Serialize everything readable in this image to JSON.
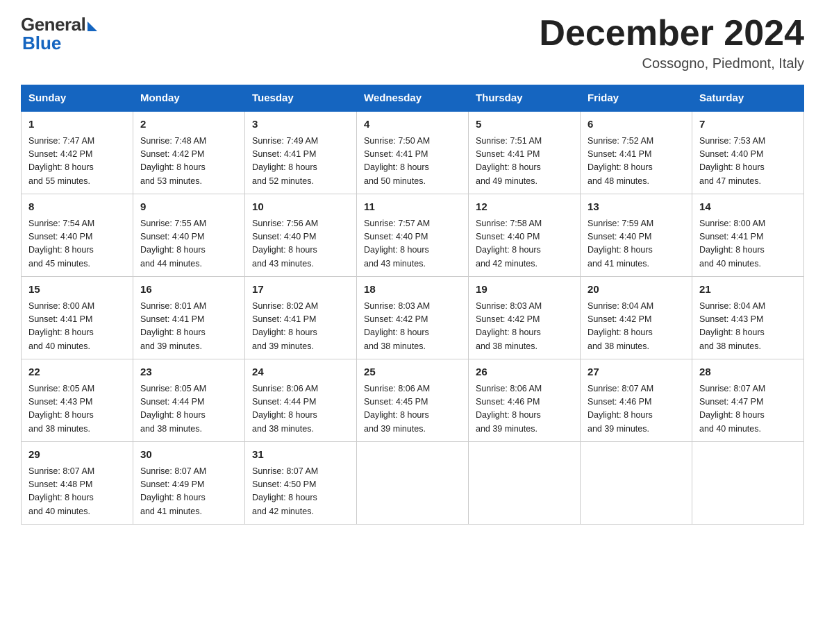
{
  "header": {
    "logo_general": "General",
    "logo_blue": "Blue",
    "month_title": "December 2024",
    "location": "Cossogno, Piedmont, Italy"
  },
  "days_of_week": [
    "Sunday",
    "Monday",
    "Tuesday",
    "Wednesday",
    "Thursday",
    "Friday",
    "Saturday"
  ],
  "weeks": [
    [
      {
        "day": "1",
        "info": "Sunrise: 7:47 AM\nSunset: 4:42 PM\nDaylight: 8 hours\nand 55 minutes."
      },
      {
        "day": "2",
        "info": "Sunrise: 7:48 AM\nSunset: 4:42 PM\nDaylight: 8 hours\nand 53 minutes."
      },
      {
        "day": "3",
        "info": "Sunrise: 7:49 AM\nSunset: 4:41 PM\nDaylight: 8 hours\nand 52 minutes."
      },
      {
        "day": "4",
        "info": "Sunrise: 7:50 AM\nSunset: 4:41 PM\nDaylight: 8 hours\nand 50 minutes."
      },
      {
        "day": "5",
        "info": "Sunrise: 7:51 AM\nSunset: 4:41 PM\nDaylight: 8 hours\nand 49 minutes."
      },
      {
        "day": "6",
        "info": "Sunrise: 7:52 AM\nSunset: 4:41 PM\nDaylight: 8 hours\nand 48 minutes."
      },
      {
        "day": "7",
        "info": "Sunrise: 7:53 AM\nSunset: 4:40 PM\nDaylight: 8 hours\nand 47 minutes."
      }
    ],
    [
      {
        "day": "8",
        "info": "Sunrise: 7:54 AM\nSunset: 4:40 PM\nDaylight: 8 hours\nand 45 minutes."
      },
      {
        "day": "9",
        "info": "Sunrise: 7:55 AM\nSunset: 4:40 PM\nDaylight: 8 hours\nand 44 minutes."
      },
      {
        "day": "10",
        "info": "Sunrise: 7:56 AM\nSunset: 4:40 PM\nDaylight: 8 hours\nand 43 minutes."
      },
      {
        "day": "11",
        "info": "Sunrise: 7:57 AM\nSunset: 4:40 PM\nDaylight: 8 hours\nand 43 minutes."
      },
      {
        "day": "12",
        "info": "Sunrise: 7:58 AM\nSunset: 4:40 PM\nDaylight: 8 hours\nand 42 minutes."
      },
      {
        "day": "13",
        "info": "Sunrise: 7:59 AM\nSunset: 4:40 PM\nDaylight: 8 hours\nand 41 minutes."
      },
      {
        "day": "14",
        "info": "Sunrise: 8:00 AM\nSunset: 4:41 PM\nDaylight: 8 hours\nand 40 minutes."
      }
    ],
    [
      {
        "day": "15",
        "info": "Sunrise: 8:00 AM\nSunset: 4:41 PM\nDaylight: 8 hours\nand 40 minutes."
      },
      {
        "day": "16",
        "info": "Sunrise: 8:01 AM\nSunset: 4:41 PM\nDaylight: 8 hours\nand 39 minutes."
      },
      {
        "day": "17",
        "info": "Sunrise: 8:02 AM\nSunset: 4:41 PM\nDaylight: 8 hours\nand 39 minutes."
      },
      {
        "day": "18",
        "info": "Sunrise: 8:03 AM\nSunset: 4:42 PM\nDaylight: 8 hours\nand 38 minutes."
      },
      {
        "day": "19",
        "info": "Sunrise: 8:03 AM\nSunset: 4:42 PM\nDaylight: 8 hours\nand 38 minutes."
      },
      {
        "day": "20",
        "info": "Sunrise: 8:04 AM\nSunset: 4:42 PM\nDaylight: 8 hours\nand 38 minutes."
      },
      {
        "day": "21",
        "info": "Sunrise: 8:04 AM\nSunset: 4:43 PM\nDaylight: 8 hours\nand 38 minutes."
      }
    ],
    [
      {
        "day": "22",
        "info": "Sunrise: 8:05 AM\nSunset: 4:43 PM\nDaylight: 8 hours\nand 38 minutes."
      },
      {
        "day": "23",
        "info": "Sunrise: 8:05 AM\nSunset: 4:44 PM\nDaylight: 8 hours\nand 38 minutes."
      },
      {
        "day": "24",
        "info": "Sunrise: 8:06 AM\nSunset: 4:44 PM\nDaylight: 8 hours\nand 38 minutes."
      },
      {
        "day": "25",
        "info": "Sunrise: 8:06 AM\nSunset: 4:45 PM\nDaylight: 8 hours\nand 39 minutes."
      },
      {
        "day": "26",
        "info": "Sunrise: 8:06 AM\nSunset: 4:46 PM\nDaylight: 8 hours\nand 39 minutes."
      },
      {
        "day": "27",
        "info": "Sunrise: 8:07 AM\nSunset: 4:46 PM\nDaylight: 8 hours\nand 39 minutes."
      },
      {
        "day": "28",
        "info": "Sunrise: 8:07 AM\nSunset: 4:47 PM\nDaylight: 8 hours\nand 40 minutes."
      }
    ],
    [
      {
        "day": "29",
        "info": "Sunrise: 8:07 AM\nSunset: 4:48 PM\nDaylight: 8 hours\nand 40 minutes."
      },
      {
        "day": "30",
        "info": "Sunrise: 8:07 AM\nSunset: 4:49 PM\nDaylight: 8 hours\nand 41 minutes."
      },
      {
        "day": "31",
        "info": "Sunrise: 8:07 AM\nSunset: 4:50 PM\nDaylight: 8 hours\nand 42 minutes."
      },
      {
        "day": "",
        "info": ""
      },
      {
        "day": "",
        "info": ""
      },
      {
        "day": "",
        "info": ""
      },
      {
        "day": "",
        "info": ""
      }
    ]
  ]
}
